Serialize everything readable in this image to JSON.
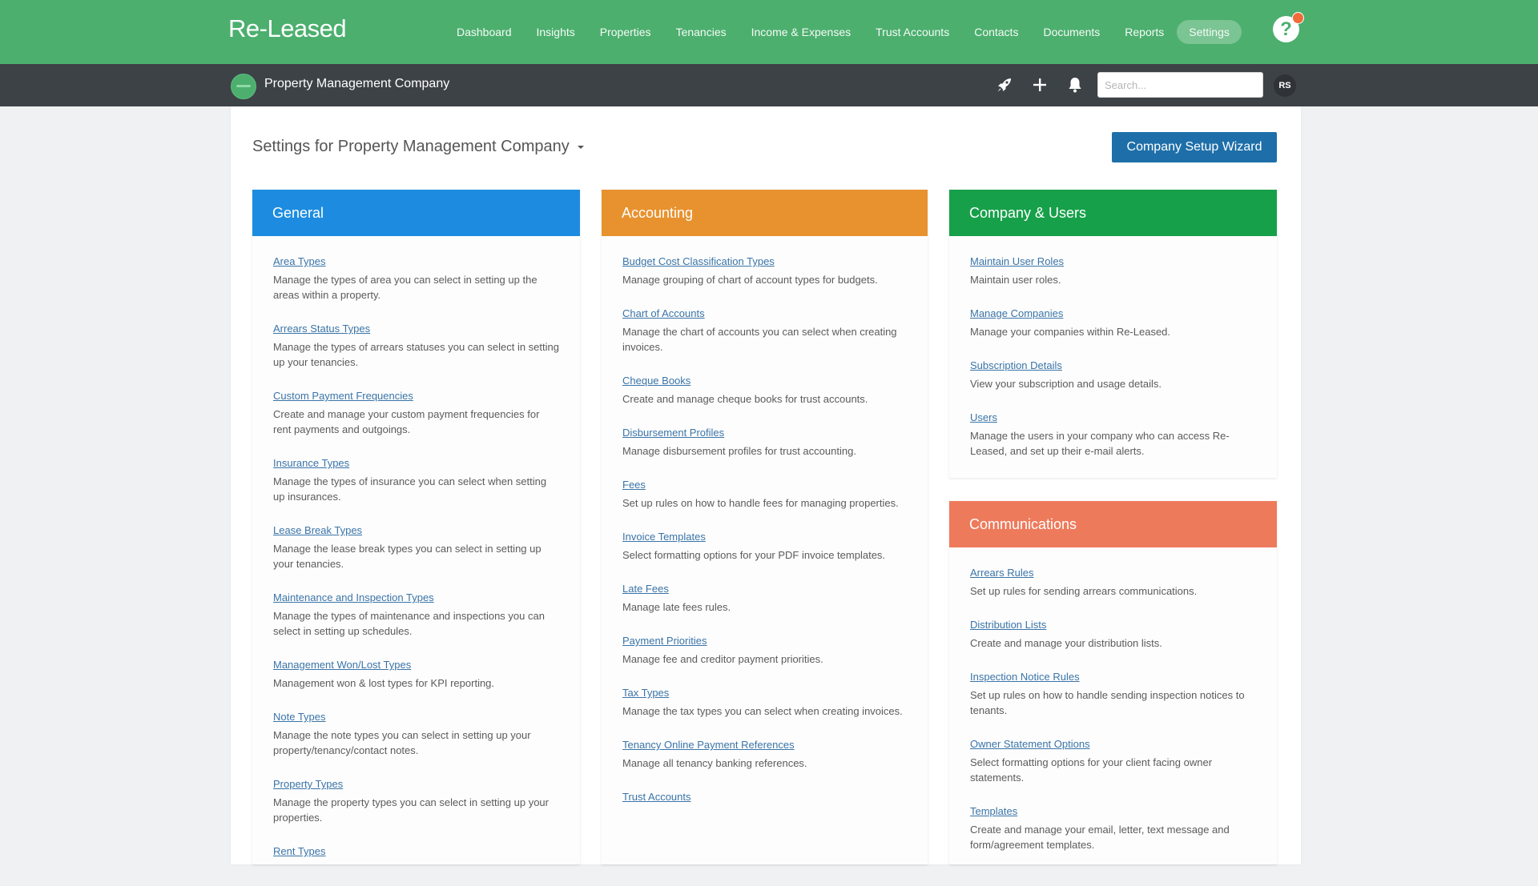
{
  "app": {
    "logo": "Re-Leased",
    "nav": [
      "Dashboard",
      "Insights",
      "Properties",
      "Tenancies",
      "Income & Expenses",
      "Trust Accounts",
      "Contacts",
      "Documents",
      "Reports"
    ],
    "nav_active": "Settings",
    "help_label": "?"
  },
  "subbar": {
    "company_name": "Property Management Company",
    "search_placeholder": "Search...",
    "avatar_initials": "RS"
  },
  "page": {
    "title_prefix": "Settings for",
    "title_company": "Property Management Company",
    "wizard_button": "Company Setup Wizard"
  },
  "colors": {
    "general": "#1d8ce0",
    "accounting": "#e8922f",
    "company_users": "#17a04a",
    "communications": "#ee7a5c"
  },
  "general": {
    "header": "General",
    "items": [
      {
        "title": "Area Types",
        "desc": "Manage the types of area you can select in setting up the areas within a property."
      },
      {
        "title": "Arrears Status Types",
        "desc": "Manage the types of arrears statuses you can select in setting up your tenancies."
      },
      {
        "title": "Custom Payment Frequencies",
        "desc": "Create and manage your custom payment frequencies for rent payments and outgoings."
      },
      {
        "title": "Insurance Types",
        "desc": "Manage the types of insurance you can select when setting up insurances."
      },
      {
        "title": "Lease Break Types",
        "desc": "Manage the lease break types you can select in setting up your tenancies."
      },
      {
        "title": "Maintenance and Inspection Types",
        "desc": "Manage the types of maintenance and inspections you can select in setting up schedules."
      },
      {
        "title": "Management Won/Lost Types",
        "desc": "Management won & lost types for KPI reporting."
      },
      {
        "title": "Note Types",
        "desc": "Manage the note types you can select in setting up your property/tenancy/contact notes."
      },
      {
        "title": "Property Types",
        "desc": "Manage the property types you can select in setting up your properties."
      },
      {
        "title": "Rent Types",
        "desc": ""
      }
    ]
  },
  "accounting": {
    "header": "Accounting",
    "items": [
      {
        "title": "Budget Cost Classification Types",
        "desc": "Manage grouping of chart of account types for budgets."
      },
      {
        "title": "Chart of Accounts",
        "desc": "Manage the chart of accounts you can select when creating invoices."
      },
      {
        "title": "Cheque Books",
        "desc": "Create and manage cheque books for trust accounts."
      },
      {
        "title": "Disbursement Profiles",
        "desc": "Manage disbursement profiles for trust accounting."
      },
      {
        "title": "Fees",
        "desc": "Set up rules on how to handle fees for managing properties."
      },
      {
        "title": "Invoice Templates",
        "desc": "Select formatting options for your PDF invoice templates."
      },
      {
        "title": "Late Fees",
        "desc": "Manage late fees rules."
      },
      {
        "title": "Payment Priorities",
        "desc": "Manage fee and creditor payment priorities."
      },
      {
        "title": "Tax Types",
        "desc": "Manage the tax types you can select when creating invoices."
      },
      {
        "title": "Tenancy Online Payment References",
        "desc": "Manage all tenancy banking references."
      },
      {
        "title": "Trust Accounts",
        "desc": ""
      }
    ]
  },
  "company_users": {
    "header": "Company & Users",
    "items": [
      {
        "title": "Maintain User Roles",
        "desc": "Maintain user roles."
      },
      {
        "title": "Manage Companies",
        "desc": "Manage your companies within Re-Leased."
      },
      {
        "title": "Subscription Details",
        "desc": "View your subscription and usage details."
      },
      {
        "title": "Users",
        "desc": "Manage the users in your company who can access Re-Leased, and set up their e-mail alerts."
      }
    ]
  },
  "communications": {
    "header": "Communications",
    "items": [
      {
        "title": "Arrears Rules",
        "desc": "Set up rules for sending arrears communications."
      },
      {
        "title": "Distribution Lists",
        "desc": "Create and manage your distribution lists."
      },
      {
        "title": "Inspection Notice Rules",
        "desc": "Set up rules on how to handle sending inspection notices to tenants."
      },
      {
        "title": "Owner Statement Options",
        "desc": "Select formatting options for your client facing owner statements."
      },
      {
        "title": "Templates",
        "desc": "Create and manage your email, letter, text message and form/agreement templates."
      }
    ]
  }
}
